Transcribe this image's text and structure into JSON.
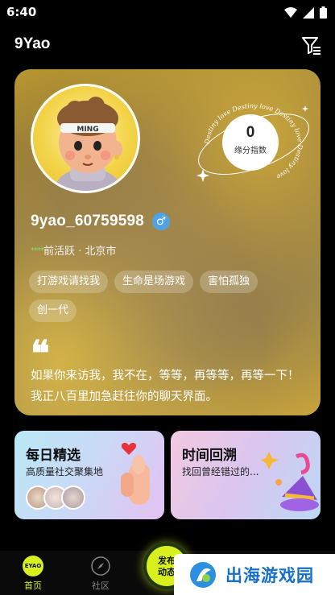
{
  "status_bar": {
    "time": "6:40"
  },
  "header": {
    "title": "9Yao"
  },
  "profile": {
    "avatar_badge": "MING",
    "orbit_text": "Destiny love Destiny love Destiny love Destiny love",
    "score_value": "0",
    "score_label": "缘分指数",
    "username": "9yao_60759598",
    "gender_symbol": "♂",
    "activity_stars": "****",
    "activity": "前活跃 · 北京市",
    "tags": [
      "打游戏请找我",
      "生命是场游戏",
      "害怕孤独",
      "创一代"
    ],
    "quote_mark": "❝",
    "bio": "如果你来访我，我不在，等等，再等等，再等一下！我正八百里加急赶往你的聊天界面。"
  },
  "cards": {
    "daily": {
      "title": "每日精选",
      "subtitle": "高质量社交聚集地"
    },
    "history": {
      "title": "时间回溯",
      "subtitle": "找回曾经错过的..."
    }
  },
  "nav": {
    "home_logo": "EYAO",
    "home_label": "首页",
    "community_label": "社区",
    "publish_label_1": "发布",
    "publish_label_2": "动态"
  },
  "watermark": {
    "text": "出海游戏园"
  },
  "colors": {
    "accent": "#d7f01e",
    "gender": "#4da3e6",
    "watermark": "#1670c8"
  }
}
